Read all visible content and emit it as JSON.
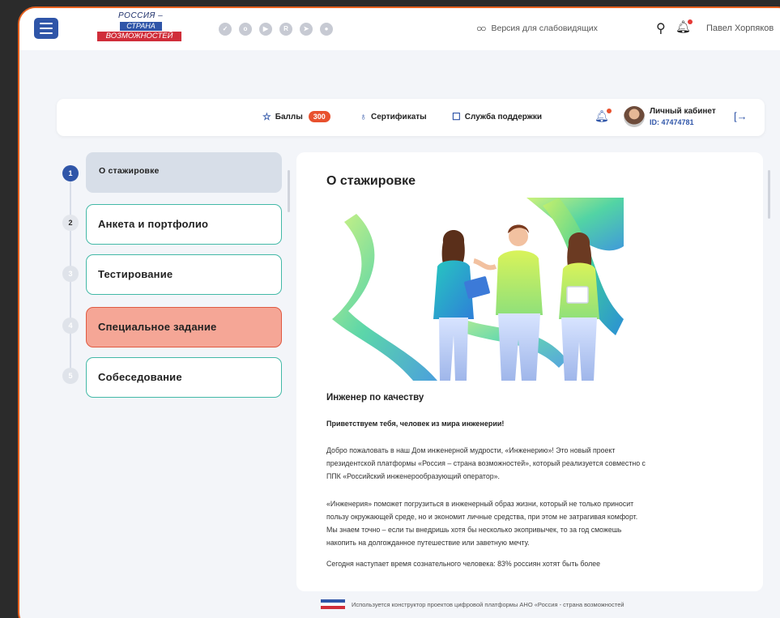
{
  "topbar": {
    "logo": {
      "line1": "РОССИЯ –",
      "line2": "СТРАНА",
      "line3": "ВОЗМОЖНОСТЕЙ"
    },
    "socials": [
      "vk-icon",
      "ok-icon",
      "youtube-icon",
      "rutube-icon",
      "telegram-icon",
      "tenchat-icon"
    ],
    "low_vision_label": "Версия для слабовидящих",
    "user_name": "Павел Хорпяков"
  },
  "navbar": {
    "points_label": "Баллы",
    "points_value": "300",
    "certificates_label": "Сертификаты",
    "support_label": "Служба поддержки",
    "cabinet_label": "Личный кабинет",
    "cabinet_id": "ID: 47474781"
  },
  "steps": [
    {
      "number": "1",
      "label": "О стажировке",
      "state": "current"
    },
    {
      "number": "2",
      "label": "Анкета и портфолио",
      "state": "outline"
    },
    {
      "number": "3",
      "label": "Тестирование",
      "state": "outline"
    },
    {
      "number": "4",
      "label": "Специальное задание",
      "state": "task"
    },
    {
      "number": "5",
      "label": "Собеседование",
      "state": "outline"
    }
  ],
  "content": {
    "title": "О стажировке",
    "subtitle": "Инженер по качеству",
    "greeting": "Приветствуем тебя, человек из мира инженерии!",
    "p1_l1": "Добро пожаловать в наш Дом инженерной мудрости, «Инженерию»! Это новый проект",
    "p1_l2": "президентской платформы «Россия – страна возможностей», который реализуется совместно с",
    "p1_l3": "ППК «Российский инженерообразующий оператор».",
    "p2_l1": "«Инженерия» поможет погрузиться в инженерный образ жизни, который не только приносит",
    "p2_l2": "пользу окружающей среде, но и экономит личные средства, при этом не затрагивая комфорт.",
    "p2_l3": "Мы знаем точно – если ты внедришь хотя бы несколько экопривычек, то за год сможешь",
    "p2_l4": "накопить на долгожданное путешествие или заветную мечту.",
    "p3_l1": "Сегодня наступает время сознательного человека: 83% россиян хотят быть более"
  },
  "footer": {
    "text": "Используется конструктор проектов цифровой платформы АНО «Россия - страна возможностей"
  },
  "colors": {
    "brand_blue": "#2f55a8",
    "accent_orange": "#e8512e",
    "teal_outline": "#43b9a7",
    "task_fill": "#f5a696",
    "frame_border": "#e7611f"
  }
}
